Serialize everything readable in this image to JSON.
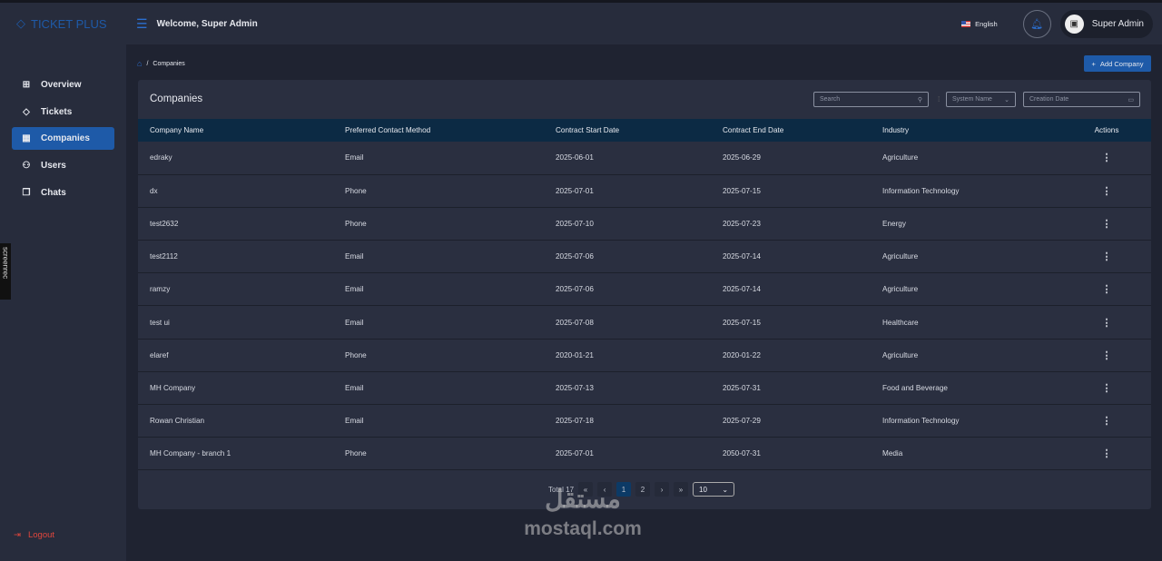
{
  "header": {
    "logo": "TICKET PLUS",
    "welcome": "Welcome, Super Admin",
    "language": "English",
    "user": "Super Admin"
  },
  "sidebar": {
    "items": [
      {
        "label": "Overview",
        "icon": "grid-icon"
      },
      {
        "label": "Tickets",
        "icon": "ticket-icon"
      },
      {
        "label": "Companies",
        "icon": "building-icon"
      },
      {
        "label": "Users",
        "icon": "users-icon"
      },
      {
        "label": "Chats",
        "icon": "chat-icon"
      }
    ],
    "logout": "Logout"
  },
  "screenrec": "screenrec",
  "breadcrumb": {
    "current": "Companies"
  },
  "add_button": "Add Company",
  "card": {
    "title": "Companies",
    "search_placeholder": "Search",
    "system_name": "System Name",
    "creation_date": "Creation Date"
  },
  "table": {
    "headers": [
      "Company Name",
      "Preferred Contact Method",
      "Contract Start Date",
      "Contract End Date",
      "Industry",
      "Actions"
    ],
    "rows": [
      [
        "edraky",
        "Email",
        "2025-06-01",
        "2025-06-29",
        "Agriculture"
      ],
      [
        "dx",
        "Phone",
        "2025-07-01",
        "2025-07-15",
        "Information Technology"
      ],
      [
        "test2632",
        "Phone",
        "2025-07-10",
        "2025-07-23",
        "Energy"
      ],
      [
        "test2112",
        "Email",
        "2025-07-06",
        "2025-07-14",
        "Agriculture"
      ],
      [
        "ramzy",
        "Email",
        "2025-07-06",
        "2025-07-14",
        "Agriculture"
      ],
      [
        "test ui",
        "Email",
        "2025-07-08",
        "2025-07-15",
        "Healthcare"
      ],
      [
        "elaref",
        "Phone",
        "2020-01-21",
        "2020-01-22",
        "Agriculture"
      ],
      [
        "MH Company",
        "Email",
        "2025-07-13",
        "2025-07-31",
        "Food and Beverage"
      ],
      [
        "Rowan Christian",
        "Email",
        "2025-07-18",
        "2025-07-29",
        "Information Technology"
      ],
      [
        "MH Company - branch 1",
        "Phone",
        "2025-07-01",
        "2050-07-31",
        "Media"
      ]
    ]
  },
  "pagination": {
    "total": "Total 17",
    "pages": [
      "1",
      "2"
    ],
    "current": "1",
    "page_size": "10"
  },
  "watermark": "mostaql.com"
}
